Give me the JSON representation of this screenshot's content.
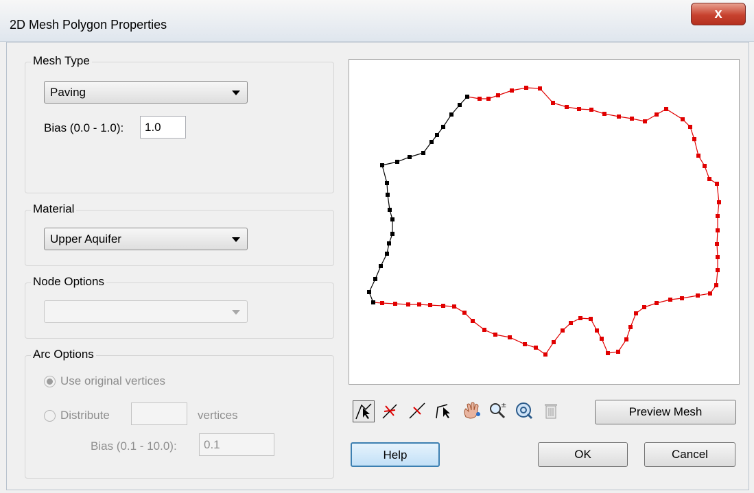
{
  "window": {
    "title": "2D Mesh Polygon Properties",
    "close_label": "x"
  },
  "mesh_type": {
    "group_label": "Mesh Type",
    "selected": "Paving",
    "bias_label": "Bias (0.0 - 1.0):",
    "bias_value": "1.0"
  },
  "material": {
    "group_label": "Material",
    "selected": "Upper Aquifer"
  },
  "node_options": {
    "group_label": "Node Options",
    "selected": ""
  },
  "arc_options": {
    "group_label": "Arc Options",
    "use_original_label": "Use original vertices",
    "distribute_label": "Distribute",
    "distribute_value": "",
    "vertices_label": "vertices",
    "bias_label": "Bias (0.1 - 10.0):",
    "bias_value": "0.1"
  },
  "toolbar": {
    "tools": [
      {
        "name": "select-arc-icon",
        "glyph": "↖"
      },
      {
        "name": "select-vertex-icon",
        "glyph": "✶"
      },
      {
        "name": "split-arc-icon",
        "glyph": "⟋"
      },
      {
        "name": "select-point-icon",
        "glyph": "↖"
      },
      {
        "name": "pan-icon",
        "glyph": "✋"
      },
      {
        "name": "zoom-icon",
        "glyph": "🔍"
      },
      {
        "name": "frame-icon",
        "glyph": "◎"
      },
      {
        "name": "delete-icon",
        "glyph": "🗑"
      }
    ]
  },
  "buttons": {
    "preview_mesh": "Preview Mesh",
    "help": "Help",
    "ok": "OK",
    "cancel": "Cancel"
  },
  "colors": {
    "selected_arc": "#000000",
    "other_arc": "#e00000"
  }
}
